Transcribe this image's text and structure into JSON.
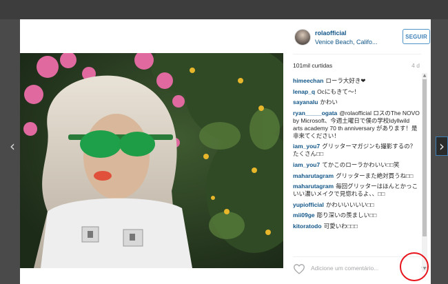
{
  "header": {
    "username": "rolaofficial",
    "location": "Venice Beach, Califo...",
    "follow_label": "SEGUIR"
  },
  "stats": {
    "likes": "101mil curtidas",
    "age": "4 d"
  },
  "comments": [
    {
      "user": "himeechan",
      "text": "ローラ大好き❤"
    },
    {
      "user": "lenap_q",
      "text": "Ocにもきて〜！"
    },
    {
      "user": "sayanalu",
      "text": "かわい"
    },
    {
      "user": "ryan_____ogata",
      "text": "@rolaofficial ロスのThe NOVO by Microsoft、今週土曜日で僕の学校Idyllwild arts academy 70 th anniversary があります！是非来てください！"
    },
    {
      "user": "iam_you7",
      "text": "グリッターマガジンも撮影するの？たくさん□□"
    },
    {
      "user": "iam_you7",
      "text": "てかこのローラかわいい□□笑"
    },
    {
      "user": "maharutagram",
      "text": "グリッターまた絶対買うね□□"
    },
    {
      "user": "maharutagram",
      "text": "毎回グリッターはほんとかっこいい濃いメイクで見惚れるよ、、□□"
    },
    {
      "user": "yupiofficial",
      "text": "かわいいいいい□□"
    },
    {
      "user": "mii09ge",
      "text": "彫り深いの羨ましい□□"
    },
    {
      "user": "kitoratodo",
      "text": "可愛いわ□□□"
    }
  ],
  "footer": {
    "comment_placeholder": "Adicione um comentário...",
    "more_label": "···"
  },
  "nav": {
    "prev": "‹",
    "next": "›"
  },
  "colors": {
    "link": "#125688",
    "follow_border": "#4f93c6",
    "highlight_circle": "#e8141c"
  }
}
